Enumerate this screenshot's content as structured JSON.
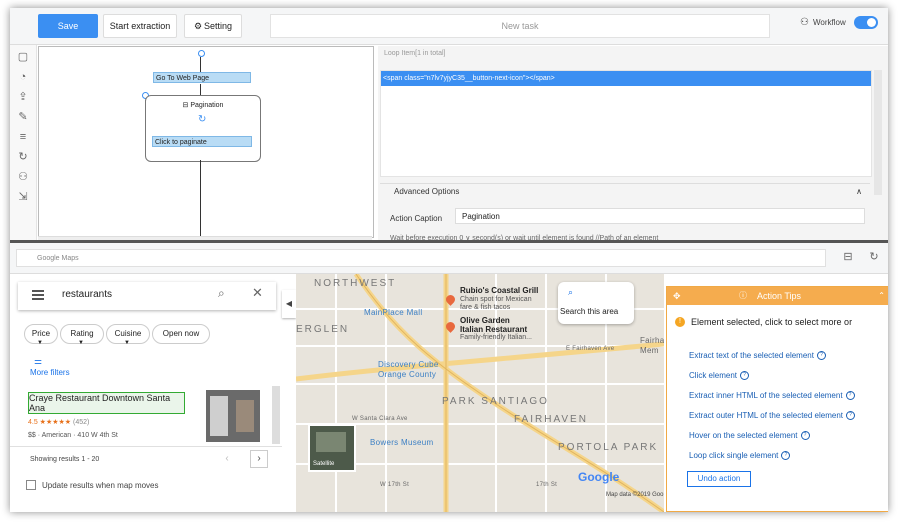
{
  "toolbar": {
    "save_label": "Save",
    "start_extraction_label": "Start extraction",
    "setting_label": "Setting",
    "task_title": "New task",
    "workflow_label": "Workflow"
  },
  "workflow": {
    "go_to_web_page": "Go To Web Page",
    "pagination": "Pagination",
    "click_to_paginate": "Click to paginate"
  },
  "loop_panel": {
    "header": "Loop Item[1 in total]",
    "item": "<span class=\"n7lv7yjyC35__button-next-icon\"></span>",
    "advanced_options": "Advanced Options",
    "action_caption_label": "Action Caption",
    "action_caption_value": "Pagination",
    "wait_row": "Wait before execution    0    ∨    second(s) or wait until element is found    //Path of an element"
  },
  "browser": {
    "address": "Google Maps"
  },
  "gmaps": {
    "search_value": "restaurants",
    "chips": [
      "Price",
      "Rating",
      "Cuisine",
      "Open now"
    ],
    "more_filters": "More filters",
    "result": {
      "title": "Craye Restaurant Downtown Santa Ana",
      "rating": "4.5 ★★★★★",
      "rating_count": "(452)",
      "meta": "$$ · American · 410 W 4th St"
    },
    "showing": "Showing results 1 - 20",
    "update_label": "Update results when map moves"
  },
  "map": {
    "labels": {
      "northwest": "NORTHWEST",
      "rgl": "ERGLEN",
      "park_santiago": "PARK SANTIAGO",
      "fairhaven": "FAIRHAVEN",
      "portola_park": "PORTOLA PARK",
      "mainplace": "MainPlace Mall",
      "discovery_1": "Discovery Cube",
      "discovery_2": "Orange County",
      "bowers": "Bowers Museum",
      "santa_clara": "W Santa Clara Ave",
      "fairhaven_ave": "E Fairhaven Ave",
      "fairhaven_side": "Fairha",
      "fairhaven_side2": "Mem",
      "w17th": "W 17th St",
      "e17th": "17th St"
    },
    "poi": [
      {
        "name": "Rubio's Coastal Grill",
        "sub1": "Chain spot for Mexican",
        "sub2": "fare & fish tacos"
      },
      {
        "name": "Olive Garden",
        "name2": "Italian Restaurant",
        "sub1": "Family-friendly Italian..."
      }
    ],
    "search_area": "Search this area",
    "satellite": "Satellite",
    "google": "Google",
    "map_data": "Map data ©2019 Goo"
  },
  "tips": {
    "title": "Action Tips",
    "status": "Element selected, click to select more or",
    "links": [
      "Extract text of the selected element",
      "Click element",
      "Extract inner HTML of the selected element",
      "Extract outer HTML of the selected element",
      "Hover on the selected element",
      "Loop click single element"
    ],
    "undo": "Undo action"
  },
  "colors": {
    "accent": "#3b8ff2",
    "tips_header": "#f5ac4e",
    "link": "#1a5fb4"
  }
}
